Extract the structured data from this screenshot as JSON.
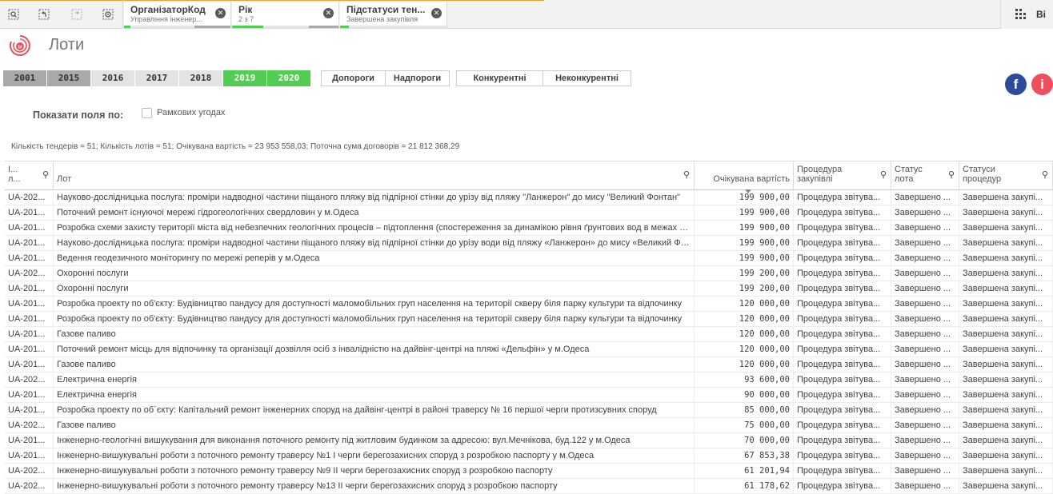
{
  "toolbar": {
    "selections": [
      {
        "title": "ОрганізаторКод",
        "subtitle": "Управління інженер..."
      },
      {
        "title": "Рік",
        "subtitle": "2 з 7"
      },
      {
        "title": "Підстатуси тен...",
        "subtitle": "Завершена закупівля"
      }
    ],
    "right_label": "Ві"
  },
  "page": {
    "title": "Лоти"
  },
  "years": [
    {
      "label": "2001",
      "state": "excluded"
    },
    {
      "label": "2015",
      "state": "excluded"
    },
    {
      "label": "2016",
      "state": "optional"
    },
    {
      "label": "2017",
      "state": "optional"
    },
    {
      "label": "2018",
      "state": "optional"
    },
    {
      "label": "2019",
      "state": "selected"
    },
    {
      "label": "2020",
      "state": "selected"
    }
  ],
  "threshold_buttons": [
    "Допороги",
    "Надпороги"
  ],
  "competition_buttons": [
    "Конкурентні",
    "Неконкурентні"
  ],
  "social": {
    "facebook": "f",
    "info": "i"
  },
  "filters": {
    "show_label": "Показати поля по:",
    "framework_label": "Рамкових угодах",
    "framework_checked": false
  },
  "summary": "Кількість тендерів = 51; Кількість лотів = 51; Очікувана вартість = 23 953 558,03; Поточна сума договорів = 21 812 368,29",
  "table": {
    "columns": [
      {
        "l1": "І...",
        "l2": "л..."
      },
      {
        "l1": "",
        "l2": "Лот"
      },
      {
        "l1": "",
        "l2": "Очікувана вартість"
      },
      {
        "l1": "Процедура",
        "l2": "закупівлі"
      },
      {
        "l1": "Статус",
        "l2": "лота"
      },
      {
        "l1": "Статуси",
        "l2": "процедур"
      }
    ],
    "rows": [
      [
        "UA-202...",
        "Науково-дослідницька послуга: проміри надводної частини піщаного пляжу від підпірної стінки до урізу від пляжу \"Ланжерон\" до мису \"Великий Фонтан\"",
        "199 900,00",
        "Процедура звітува...",
        "Завершено ...",
        "Завершена закупі..."
      ],
      [
        "UA-201...",
        "Поточний ремонт існуючої мережі гідрогеологічних свердловин у м.Одеса",
        "199 900,00",
        "Процедура звітува...",
        "Завершено ...",
        "Завершена закупі..."
      ],
      [
        "UA-201...",
        "Розробка схеми захисту території міста від небезпечних геологічних процесів – підтоплення (спостереження за динамікою рівня ґрунтових вод в межах міста)",
        "199 900,00",
        "Процедура звітува...",
        "Завершено ...",
        "Завершена закупі..."
      ],
      [
        "UA-201...",
        "Науково-дослідницька послуга: проміри надводної частини піщаного пляжу від підпірної стінки до урізу води від пляжу «Ланжерон» до мису «Великий Фонтан»",
        "199 900,00",
        "Процедура звітува...",
        "Завершено ...",
        "Завершена закупі..."
      ],
      [
        "UA-201...",
        "Ведення геодезичного моніторингу по мережі реперів у м.Одеса",
        "199 900,00",
        "Процедура звітува...",
        "Завершено ...",
        "Завершена закупі..."
      ],
      [
        "UA-202...",
        "Охоронні послуги",
        "199 200,00",
        "Процедура звітува...",
        "Завершено ...",
        "Завершена закупі..."
      ],
      [
        "UA-201...",
        "Охоронні послуги",
        "199 200,00",
        "Процедура звітува...",
        "Завершено ...",
        "Завершена закупі..."
      ],
      [
        "UA-201...",
        "Розробка проекту по об'єкту: Будівництво пандусу для доступності маломобільних груп населення на території скверу біля парку культури та відпочинку",
        "120 000,00",
        "Процедура звітува...",
        "Завершено ...",
        "Завершена закупі..."
      ],
      [
        "UA-201...",
        "Розробка проекту по об'єкту: Будівництво пандусу для доступності маломобільних груп населення на території скверу біля парку культури та відпочинку",
        "120 000,00",
        "Процедура звітува...",
        "Завершено ...",
        "Завершена закупі..."
      ],
      [
        "UA-201...",
        "Газове паливо",
        "120 000,00",
        "Процедура звітува...",
        "Завершено ...",
        "Завершена закупі..."
      ],
      [
        "UA-201...",
        "Поточний ремонт місць для відпочинку та організації дозвілля осіб з інвалідністю на дайвінг-центрі на пляжі «Дельфін» у м.Одеса",
        "120 000,00",
        "Процедура звітува...",
        "Завершено ...",
        "Завершена закупі..."
      ],
      [
        "UA-201...",
        "Газове паливо",
        "120 000,00",
        "Процедура звітува...",
        "Завершено ...",
        "Завершена закупі..."
      ],
      [
        "UA-202...",
        "Електрична енергія",
        "93 600,00",
        "Процедура звітува...",
        "Завершено ...",
        "Завершена закупі..."
      ],
      [
        "UA-201...",
        "Електрична енергія",
        "90 000,00",
        "Процедура звітува...",
        "Завершено ...",
        "Завершена закупі..."
      ],
      [
        "UA-201...",
        "Розробка проекту по об´єкту: Капітальний ремонт інженерних споруд на дайвінг-центрі в районі траверсу № 16 першої черги протизсувних споруд",
        "85 000,00",
        "Процедура звітува...",
        "Завершено ...",
        "Завершена закупі..."
      ],
      [
        "UA-202...",
        "Газове паливо",
        "75 000,00",
        "Процедура звітува...",
        "Завершено ...",
        "Завершена закупі..."
      ],
      [
        "UA-201...",
        "Інженерно-геологічні вишукування для виконання поточного ремонту під житловим будинком за адресою: вул.Мечнікова, буд.122 у м.Одеса",
        "70 000,00",
        "Процедура звітува...",
        "Завершено ...",
        "Завершена закупі..."
      ],
      [
        "UA-201...",
        "Інженерно-вишукувальні роботи з поточного ремонту траверсу №1 І черги берегозахисних споруд з розробкою паспорту у м.Одеса",
        "67 853,38",
        "Процедура звітува...",
        "Завершено ...",
        "Завершена закупі..."
      ],
      [
        "UA-202...",
        "Інженерно-вишукувальні роботи з поточного ремонту траверсу №9 ІІ черги берегозахисних споруд з розробкою паспорту",
        "61 201,94",
        "Процедура звітува...",
        "Завершено ...",
        "Завершена закупі..."
      ],
      [
        "UA-202...",
        "Інженерно-вишукувальні роботи з поточного ремонту траверсу №13 ІІ черги берегозахисних споруд з розробкою паспорту",
        "61 178,62",
        "Процедура звітува...",
        "Завершено ...",
        "Завершена закупі..."
      ]
    ]
  }
}
